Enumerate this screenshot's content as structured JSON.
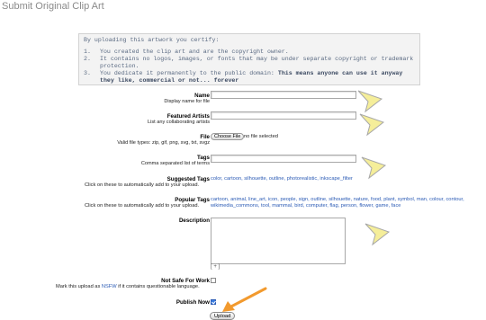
{
  "page": {
    "title": "Submit Original Clip Art"
  },
  "certification": {
    "intro": "By uploading this artwork you certify:",
    "items": [
      {
        "num": "1.",
        "text": "You created the clip art and are the copyright owner."
      },
      {
        "num": "2.",
        "text": "It contains no logos, images, or fonts that may be under separate copyright or trademark protection."
      },
      {
        "num": "3.",
        "text_plain": "You dedicate it permanently to the public domain: ",
        "text_bold": "This means anyone can use it anyway they like, commercial or not... forever"
      }
    ]
  },
  "fields": {
    "name": {
      "label": "Name",
      "hint": "Display name for file",
      "value": ""
    },
    "artists": {
      "label": "Featured Artists",
      "hint": "List any collaborating artists",
      "value": ""
    },
    "file": {
      "label": "File",
      "button": "Choose File",
      "status": "no file selected",
      "hint": "Valid file types: zip, gif, png, svg, txt, svgz"
    },
    "tags": {
      "label": "Tags",
      "hint": "Comma separated list of terms",
      "value": ""
    },
    "description": {
      "label": "Description",
      "value": "",
      "expand": "[ + ]"
    },
    "nsfw": {
      "label": "Not Safe For Work",
      "note_before": "Mark this upload as ",
      "note_link": "NSFW",
      "note_after": " if it contains questionable language.",
      "checked": false
    },
    "publish": {
      "label": "Publish Now",
      "checked": true
    }
  },
  "suggested_tags": {
    "label": "Suggested Tags",
    "tags": "color, cartoon, silhouette, outline, photorealistic, inkscape_filter",
    "note": "Click on these to automatically add to your upload."
  },
  "popular_tags": {
    "label": "Popular Tags",
    "tags_line1": "cartoon, animal, line_art, icon, people, sign, outline, silhouette, nature, food, plant, symbol, man, colour, contour,",
    "tags_line2": "wikimedia_commons, tool, mammal, bird, computer, flag, person, flower, game, face",
    "note": "Click on these to automatically add to your upload."
  },
  "actions": {
    "upload": "Upload"
  },
  "annotation_colors": {
    "yellow_arrow": "#f5ee9a",
    "yellow_arrow_border": "#a8a8a8",
    "orange_arrow": "#f29a2e"
  }
}
